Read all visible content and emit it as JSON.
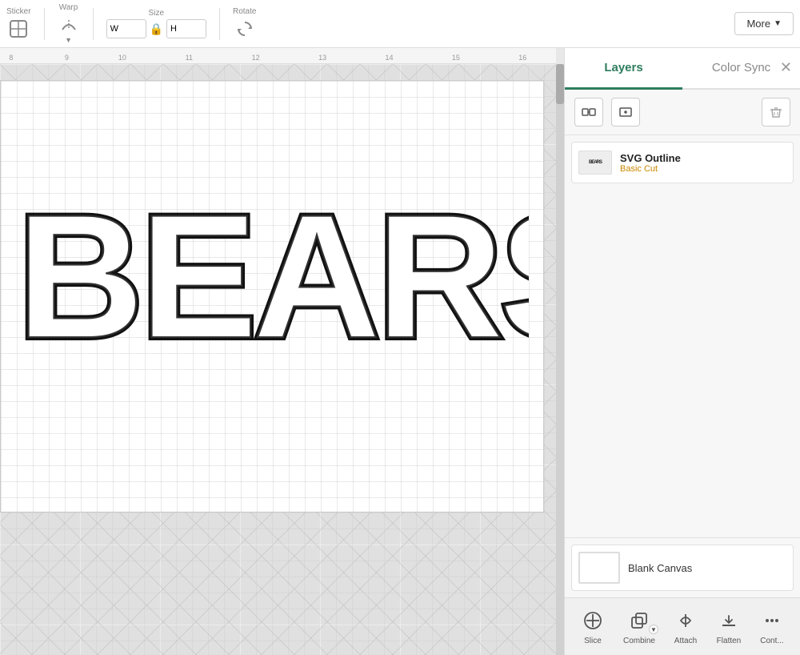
{
  "toolbar": {
    "sticker_label": "Sticker",
    "warp_label": "Warp",
    "size_label": "Size",
    "rotate_label": "Rotate",
    "more_label": "More",
    "width_value": "W",
    "height_value": "H",
    "lock_icon": "🔒"
  },
  "ruler": {
    "marks": [
      "8",
      "9",
      "10",
      "11",
      "12",
      "13",
      "14",
      "15",
      "16"
    ]
  },
  "canvas": {
    "bears_text": "BEARS"
  },
  "right_panel": {
    "tabs": [
      {
        "label": "Layers",
        "id": "layers",
        "active": true
      },
      {
        "label": "Color Sync",
        "id": "colorsync",
        "active": false
      }
    ],
    "panel_tools": [
      {
        "label": "group-icon",
        "unicode": "⊞"
      },
      {
        "label": "ungroup-icon",
        "unicode": "⊟"
      },
      {
        "label": "trash-icon",
        "unicode": "🗑"
      }
    ],
    "layers": [
      {
        "name": "SVG Outline",
        "type": "Basic Cut",
        "thumb_text": "BEARS"
      }
    ],
    "blank_canvas": {
      "label": "Blank Canvas"
    },
    "actions": [
      {
        "label": "Slice",
        "icon": "✂",
        "disabled": false,
        "has_arrow": false
      },
      {
        "label": "Combine",
        "icon": "⊕",
        "disabled": false,
        "has_arrow": true
      },
      {
        "label": "Attach",
        "icon": "🔗",
        "disabled": false,
        "has_arrow": false
      },
      {
        "label": "Flatten",
        "icon": "⬇",
        "disabled": false,
        "has_arrow": false
      },
      {
        "label": "Cont...",
        "icon": "⋯",
        "disabled": false,
        "has_arrow": false
      }
    ]
  },
  "colors": {
    "active_tab": "#2e7d5e",
    "layer_type": "#cc8800",
    "accent": "#2e7d5e"
  }
}
